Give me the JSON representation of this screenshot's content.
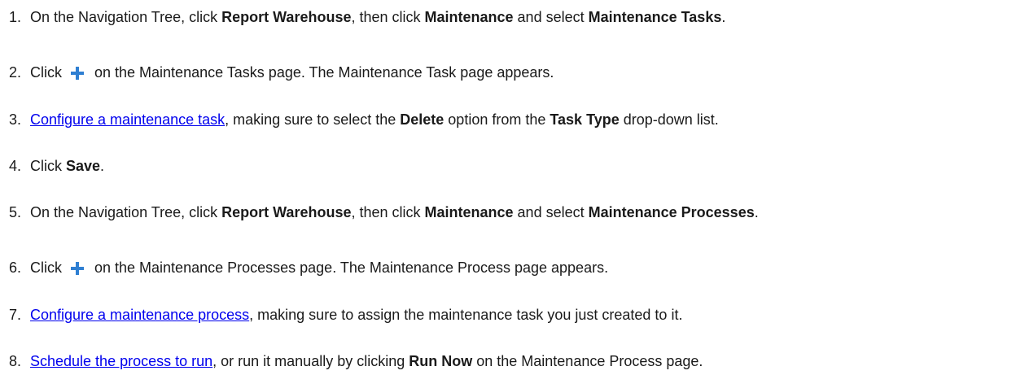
{
  "steps": [
    {
      "number": "1.",
      "segments": [
        {
          "t": "text",
          "v": "On the Navigation Tree, click "
        },
        {
          "t": "bold",
          "v": "Report Warehouse"
        },
        {
          "t": "text",
          "v": ", then click "
        },
        {
          "t": "bold",
          "v": "Maintenance"
        },
        {
          "t": "text",
          "v": " and select "
        },
        {
          "t": "bold",
          "v": "Maintenance Tasks"
        },
        {
          "t": "text",
          "v": "."
        }
      ]
    },
    {
      "number": "2.",
      "segments": [
        {
          "t": "text",
          "v": "Click"
        },
        {
          "t": "icon",
          "v": "plus-icon",
          "color": "#2f7fd2"
        },
        {
          "t": "text",
          "v": "on the Maintenance Tasks page. The Maintenance Task page appears."
        }
      ]
    },
    {
      "number": "3.",
      "segments": [
        {
          "t": "link",
          "v": "Configure a maintenance task"
        },
        {
          "t": "text",
          "v": ", making sure to select the "
        },
        {
          "t": "bold",
          "v": "Delete"
        },
        {
          "t": "text",
          "v": " option from the "
        },
        {
          "t": "bold",
          "v": "Task Type"
        },
        {
          "t": "text",
          "v": " drop-down list."
        }
      ]
    },
    {
      "number": "4.",
      "segments": [
        {
          "t": "text",
          "v": "Click "
        },
        {
          "t": "bold",
          "v": "Save"
        },
        {
          "t": "text",
          "v": "."
        }
      ]
    },
    {
      "number": "5.",
      "segments": [
        {
          "t": "text",
          "v": "On the Navigation Tree, click "
        },
        {
          "t": "bold",
          "v": "Report Warehouse"
        },
        {
          "t": "text",
          "v": ", then click "
        },
        {
          "t": "bold",
          "v": "Maintenance"
        },
        {
          "t": "text",
          "v": " and select "
        },
        {
          "t": "bold",
          "v": "Maintenance Processes"
        },
        {
          "t": "text",
          "v": "."
        }
      ]
    },
    {
      "number": "6.",
      "segments": [
        {
          "t": "text",
          "v": "Click"
        },
        {
          "t": "icon",
          "v": "plus-icon",
          "color": "#2f7fd2"
        },
        {
          "t": "text",
          "v": "on the Maintenance Processes page. The Maintenance Process page appears."
        }
      ]
    },
    {
      "number": "7.",
      "segments": [
        {
          "t": "link",
          "v": "Configure a maintenance process"
        },
        {
          "t": "text",
          "v": ", making sure to assign the maintenance task you just created to it."
        }
      ]
    },
    {
      "number": "8.",
      "segments": [
        {
          "t": "link",
          "v": "Schedule the process to run"
        },
        {
          "t": "text",
          "v": ", or run it manually by clicking "
        },
        {
          "t": "bold",
          "v": "Run Now"
        },
        {
          "t": "text",
          "v": " on the Maintenance Process page."
        }
      ]
    }
  ],
  "colors": {
    "text": "#1a1a1a",
    "link": "#0000ee",
    "plus_icon": "#2f7fd2"
  }
}
